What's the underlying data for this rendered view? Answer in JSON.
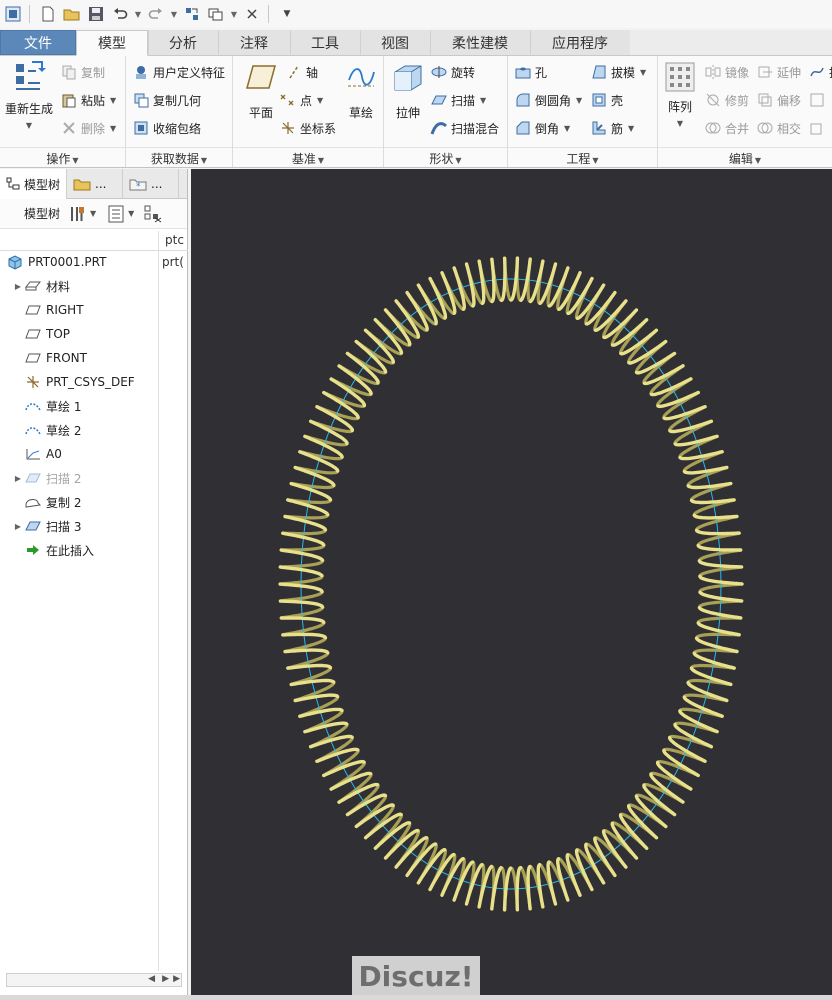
{
  "tabs": [
    "文件",
    "模型",
    "分析",
    "注释",
    "工具",
    "视图",
    "柔性建模",
    "应用程序"
  ],
  "active_tab": "模型",
  "ribbon": {
    "groups": {
      "operations": "操作",
      "get_data": "获取数据",
      "datum": "基准",
      "shapes": "形状",
      "engineering": "工程",
      "edit": "编辑"
    },
    "regenerate": "重新生成",
    "copy": "复制",
    "paste": "粘贴",
    "delete": "删除",
    "udf": "用户定义特征",
    "copy_geom": "复制几何",
    "shrinkwrap": "收缩包络",
    "plane": "平面",
    "axis": "轴",
    "point": "点",
    "csys": "坐标系",
    "sketch": "草绘",
    "extrude": "拉伸",
    "revolve": "旋转",
    "sweep": "扫描",
    "swept_blend": "扫描混合",
    "hole": "孔",
    "round": "倒圆角",
    "chamfer": "倒角",
    "draft": "拔模",
    "shell": "壳",
    "rib": "筋",
    "pattern": "阵列",
    "mirror": "镜像",
    "extend": "延伸",
    "trim": "修剪",
    "offset": "偏移",
    "merge": "合并",
    "intersect": "相交",
    "project": "投"
  },
  "panel": {
    "tabs": [
      "模型树",
      "...",
      "..."
    ],
    "toolbar_label": "模型树",
    "col_header": "ptc",
    "root_col_value": "prt(",
    "tree": [
      {
        "label": "PRT0001.PRT",
        "icon": "part-icon",
        "expand": false,
        "dim": false,
        "indent": 0
      },
      {
        "label": "材料",
        "icon": "material-icon",
        "expand": true,
        "dim": false,
        "indent": 1
      },
      {
        "label": "RIGHT",
        "icon": "datum-plane-icon",
        "expand": false,
        "dim": false,
        "indent": 1
      },
      {
        "label": "TOP",
        "icon": "datum-plane-icon",
        "expand": false,
        "dim": false,
        "indent": 1
      },
      {
        "label": "FRONT",
        "icon": "datum-plane-icon",
        "expand": false,
        "dim": false,
        "indent": 1
      },
      {
        "label": "PRT_CSYS_DEF",
        "icon": "csys-icon",
        "expand": false,
        "dim": false,
        "indent": 1
      },
      {
        "label": "草绘 1",
        "icon": "sketch-icon",
        "expand": false,
        "dim": false,
        "indent": 1
      },
      {
        "label": "草绘 2",
        "icon": "sketch-icon",
        "expand": false,
        "dim": false,
        "indent": 1
      },
      {
        "label": "A0",
        "icon": "graph-icon",
        "expand": false,
        "dim": false,
        "indent": 1
      },
      {
        "label": "扫描 2",
        "icon": "sweep-icon",
        "expand": true,
        "dim": true,
        "indent": 1
      },
      {
        "label": "复制 2",
        "icon": "copy-feature-icon",
        "expand": false,
        "dim": false,
        "indent": 1
      },
      {
        "label": "扫描 3",
        "icon": "sweep-icon",
        "expand": true,
        "dim": false,
        "indent": 1
      },
      {
        "label": "在此插入",
        "icon": "insert-here-icon",
        "expand": false,
        "dim": false,
        "indent": 1
      }
    ]
  },
  "watermark": "Discuz!",
  "colors": {
    "viewport_bg": "#2f2f34",
    "spring": "#e8e08a",
    "spring_shadow": "#a8a055",
    "path": "#2fb8e8",
    "file_tab": "#5b88b8"
  }
}
